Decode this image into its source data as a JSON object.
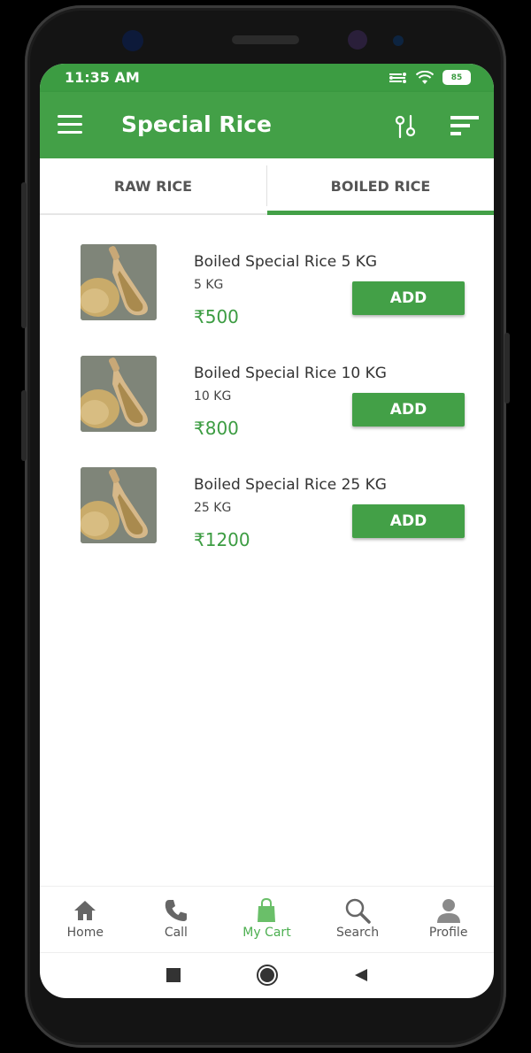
{
  "status_bar": {
    "time": "11:35 AM",
    "battery": "85"
  },
  "app_bar": {
    "title": "Special Rice",
    "menu_icon": "menu-icon",
    "filter_icon": "filter-icon",
    "sort_icon": "sort-icon"
  },
  "tabs": [
    {
      "label": "RAW RICE",
      "active": false
    },
    {
      "label": "BOILED RICE",
      "active": true
    }
  ],
  "products": [
    {
      "name": "Boiled Special Rice 5 KG",
      "weight": "5 KG",
      "price": "₹500",
      "button": "ADD"
    },
    {
      "name": "Boiled Special Rice 10 KG",
      "weight": "10 KG",
      "price": "₹800",
      "button": "ADD"
    },
    {
      "name": "Boiled Special Rice 25 KG",
      "weight": "25 KG",
      "price": "₹1200",
      "button": "ADD"
    }
  ],
  "bottom_nav": [
    {
      "label": "Home",
      "icon": "home-icon",
      "active": false
    },
    {
      "label": "Call",
      "icon": "phone-icon",
      "active": false
    },
    {
      "label": "My Cart",
      "icon": "shopping-bag-icon",
      "active": true
    },
    {
      "label": "Search",
      "icon": "search-icon",
      "active": false
    },
    {
      "label": "Profile",
      "icon": "profile-icon",
      "active": false
    }
  ],
  "colors": {
    "primary": "#43a047",
    "status_bar": "#3c9c42",
    "price": "#3c9c42",
    "active_nav": "#4caf50"
  }
}
